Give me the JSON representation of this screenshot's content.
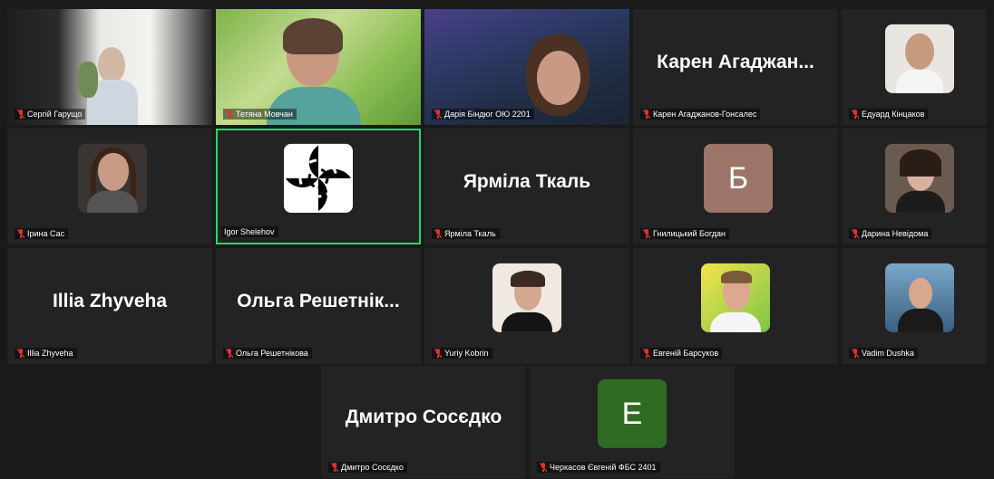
{
  "participants": [
    {
      "name": "Сергій Гарущо",
      "display": "",
      "kind": "video"
    },
    {
      "name": "Тетяна Мовчан",
      "display": "",
      "kind": "video"
    },
    {
      "name": "Дарія Біндюг ОЮ 2201",
      "display": "",
      "kind": "video"
    },
    {
      "name": "Карен Агаджанов-Гонсалес",
      "display": "Карен  Агаджан...",
      "kind": "name"
    },
    {
      "name": "Едуард Кінцаков",
      "display": "",
      "kind": "photo"
    },
    {
      "name": "Ірина Сас",
      "display": "",
      "kind": "photo"
    },
    {
      "name": "Igor Shelehov",
      "display": "",
      "kind": "pattern"
    },
    {
      "name": "Ярміла Ткаль",
      "display": "Ярміла Ткаль",
      "kind": "name"
    },
    {
      "name": "Гнилицький Богдан",
      "display": "",
      "kind": "letter",
      "letter": "Б",
      "color": "#9c7568"
    },
    {
      "name": "Дарина Невідома",
      "display": "",
      "kind": "photo"
    },
    {
      "name": "Illia Zhyveha",
      "display": "Illia Zhyveha",
      "kind": "name"
    },
    {
      "name": "Ольга Решетнікова",
      "display": "Ольга  Решетнік...",
      "kind": "name"
    },
    {
      "name": "Yuriy Kobrin",
      "display": "",
      "kind": "photo"
    },
    {
      "name": "Евгеній Барсуков",
      "display": "",
      "kind": "photo"
    },
    {
      "name": "Vadim Dushka",
      "display": "",
      "kind": "photo"
    },
    {
      "name": "Дмитро Сосєдко",
      "display": "Дмитро Сосєдко",
      "kind": "name"
    },
    {
      "name": "Черкасов Євгеній ФБС 2401",
      "display": "",
      "kind": "letter",
      "letter": "Е",
      "color": "#2f6b23"
    }
  ],
  "colors": {
    "active_border": "#23d96b",
    "muted_icon": "#e0322d"
  }
}
